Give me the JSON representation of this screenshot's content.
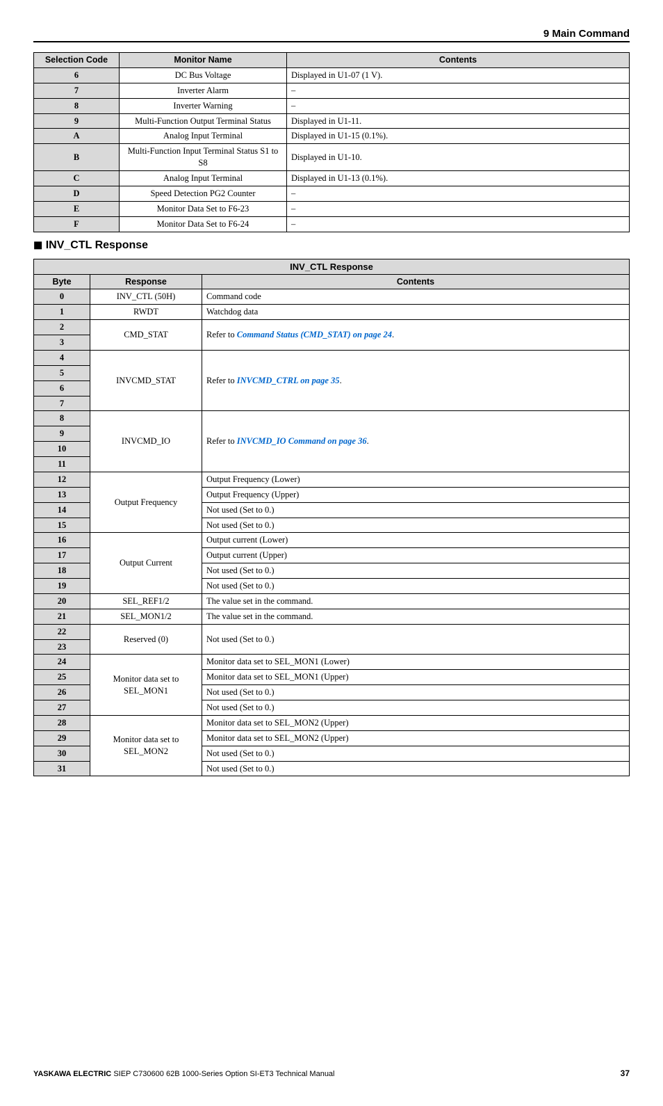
{
  "header": {
    "section": "9  Main Command"
  },
  "table1": {
    "headers": {
      "code": "Selection Code",
      "name": "Monitor Name",
      "contents": "Contents"
    },
    "rows": [
      {
        "code": "6",
        "name": "DC Bus Voltage",
        "contents": "Displayed in U1-07 (1 V)."
      },
      {
        "code": "7",
        "name": "Inverter Alarm",
        "contents": "–"
      },
      {
        "code": "8",
        "name": "Inverter Warning",
        "contents": "–"
      },
      {
        "code": "9",
        "name": "Multi-Function Output Terminal Status",
        "contents": "Displayed in U1-11."
      },
      {
        "code": "A",
        "name": "Analog Input Terminal",
        "contents": "Displayed in U1-15 (0.1%)."
      },
      {
        "code": "B",
        "name": "Multi-Function Input Terminal Status S1 to S8",
        "contents": "Displayed in U1-10."
      },
      {
        "code": "C",
        "name": "Analog Input Terminal",
        "contents": "Displayed in U1-13 (0.1%)."
      },
      {
        "code": "D",
        "name": "Speed Detection PG2 Counter",
        "contents": "–"
      },
      {
        "code": "E",
        "name": "Monitor Data Set to F6-23",
        "contents": "–"
      },
      {
        "code": "F",
        "name": "Monitor Data Set to F6-24",
        "contents": "–"
      }
    ]
  },
  "sectionHeading": "INV_CTL Response",
  "table2": {
    "caption": "INV_CTL Response",
    "headers": {
      "byte": "Byte",
      "response": "Response",
      "contents": "Contents"
    },
    "groups": [
      {
        "bytes": [
          "0"
        ],
        "response": "INV_CTL (50H)",
        "contents": [
          {
            "text": "Command code"
          }
        ]
      },
      {
        "bytes": [
          "1"
        ],
        "response": "RWDT",
        "contents": [
          {
            "text": "Watchdog data"
          }
        ]
      },
      {
        "bytes": [
          "2",
          "3"
        ],
        "response": "CMD_STAT",
        "contents": [
          {
            "prefix": "Refer to ",
            "link": "Command Status (CMD_STAT) on page 24",
            "suffix": "."
          }
        ]
      },
      {
        "bytes": [
          "4",
          "5",
          "6",
          "7"
        ],
        "response": "INVCMD_STAT",
        "contents": [
          {
            "prefix": "Refer to ",
            "link": "INVCMD_CTRL on page 35",
            "suffix": "."
          }
        ]
      },
      {
        "bytes": [
          "8",
          "9",
          "10",
          "11"
        ],
        "response": "INVCMD_IO",
        "contents": [
          {
            "prefix": "Refer to ",
            "link": "INVCMD_IO Command on page 36",
            "suffix": "."
          }
        ]
      },
      {
        "bytes": [
          "12",
          "13",
          "14",
          "15"
        ],
        "response": "Output Frequency",
        "contents": [
          {
            "text": "Output Frequency (Lower)"
          },
          {
            "text": "Output Frequency (Upper)"
          },
          {
            "text": "Not used (Set to 0.)"
          },
          {
            "text": "Not used (Set to 0.)"
          }
        ]
      },
      {
        "bytes": [
          "16",
          "17",
          "18",
          "19"
        ],
        "response": "Output Current",
        "contents": [
          {
            "text": "Output current (Lower)"
          },
          {
            "text": "Output current (Upper)"
          },
          {
            "text": "Not used (Set to 0.)"
          },
          {
            "text": "Not used (Set to 0.)"
          }
        ]
      },
      {
        "bytes": [
          "20"
        ],
        "response": "SEL_REF1/2",
        "contents": [
          {
            "text": "The value set in the command."
          }
        ]
      },
      {
        "bytes": [
          "21"
        ],
        "response": "SEL_MON1/2",
        "contents": [
          {
            "text": "The value set in the command."
          }
        ]
      },
      {
        "bytes": [
          "22",
          "23"
        ],
        "response": "Reserved (0)",
        "contents": [
          {
            "text": "Not used (Set to 0.)"
          }
        ]
      },
      {
        "bytes": [
          "24",
          "25",
          "26",
          "27"
        ],
        "response": "Monitor data set to SEL_MON1",
        "contents": [
          {
            "text": "Monitor data set to SEL_MON1 (Lower)"
          },
          {
            "text": "Monitor data set to SEL_MON1 (Upper)"
          },
          {
            "text": "Not used (Set to 0.)"
          },
          {
            "text": "Not used (Set to 0.)"
          }
        ]
      },
      {
        "bytes": [
          "28",
          "29",
          "30",
          "31"
        ],
        "response": "Monitor data set to SEL_MON2",
        "contents": [
          {
            "text": "Monitor data set to SEL_MON2 (Upper)"
          },
          {
            "text": "Monitor data set to SEL_MON2 (Upper)"
          },
          {
            "text": "Not used (Set to 0.)"
          },
          {
            "text": "Not used (Set to 0.)"
          }
        ]
      }
    ]
  },
  "footer": {
    "brand": "YASKAWA ELECTRIC",
    "doc": " SIEP C730600 62B 1000-Series Option SI-ET3 Technical Manual",
    "page": "37"
  }
}
